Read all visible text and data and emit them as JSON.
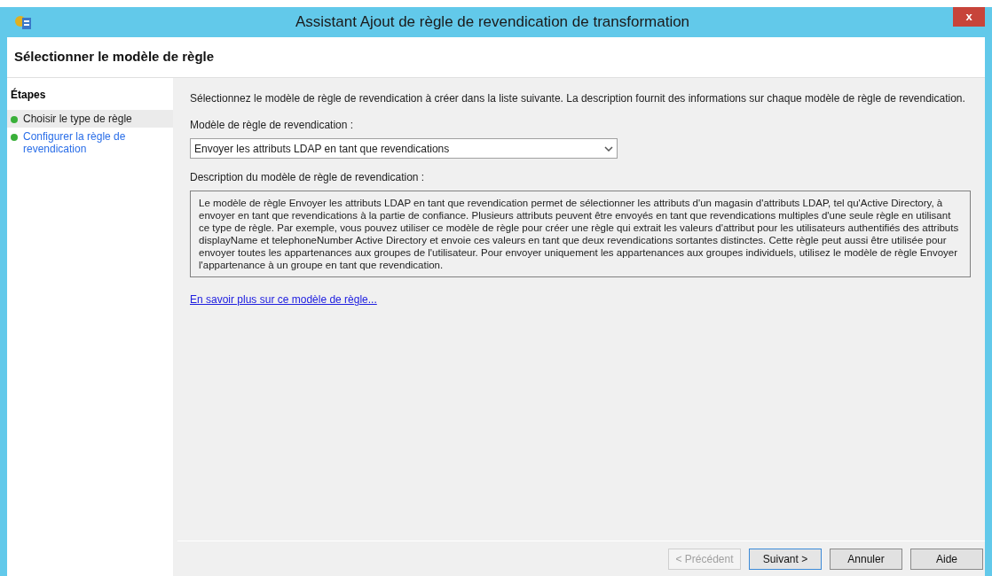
{
  "window": {
    "title": "Assistant Ajout de règle de revendication de transformation",
    "close": "x"
  },
  "header": {
    "title": "Sélectionner le modèle de règle"
  },
  "steps": {
    "title": "Étapes",
    "items": [
      {
        "label": "Choisir le type de règle",
        "selected": true
      },
      {
        "label": "Configurer la règle de revendication",
        "selected": false
      }
    ]
  },
  "content": {
    "intro": "Sélectionnez le modèle de règle de revendication à créer dans la liste suivante. La description fournit des informations sur chaque modèle de règle de revendication.",
    "template_label": "Modèle de règle de revendication :",
    "template_value": "Envoyer les attributs LDAP en tant que revendications",
    "description_label": "Description du modèle de règle de revendication :",
    "description": "Le modèle de règle Envoyer les attributs LDAP en tant que revendication permet de sélectionner les attributs d'un magasin d'attributs LDAP, tel qu'Active Directory, à envoyer en tant que revendications à la partie de confiance. Plusieurs attributs peuvent être envoyés en tant que revendications multiples d'une seule règle en utilisant ce type de règle. Par exemple, vous pouvez utiliser ce modèle de règle pour créer une règle qui extrait les valeurs d'attribut pour les utilisateurs authentifiés des attributs displayName et telephoneNumber Active Directory et envoie ces valeurs en tant que deux revendications sortantes distinctes. Cette règle peut aussi être utilisée pour envoyer toutes les appartenances aux groupes de l'utilisateur. Pour envoyer uniquement les appartenances aux groupes individuels, utilisez le modèle de règle Envoyer l'appartenance à un groupe en tant que revendication.",
    "link": "En savoir plus sur ce modèle de règle..."
  },
  "buttons": [
    {
      "label": "< Précédent",
      "disabled": true,
      "default": false
    },
    {
      "label": "Suivant >",
      "disabled": false,
      "default": true
    },
    {
      "label": "Annuler",
      "disabled": false,
      "default": false
    },
    {
      "label": "Aide",
      "disabled": false,
      "default": false
    }
  ]
}
